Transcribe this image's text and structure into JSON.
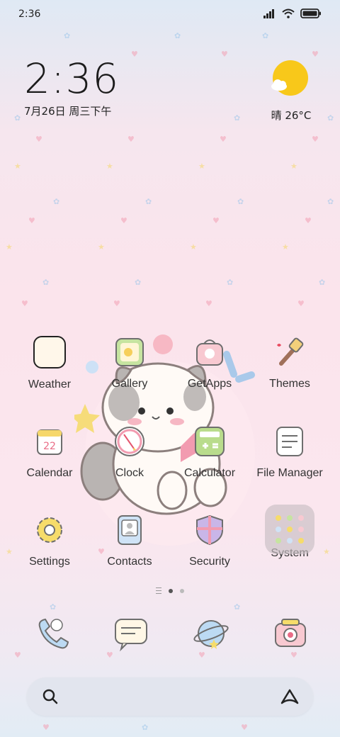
{
  "status_bar": {
    "time": "2:36"
  },
  "clock_widget": {
    "time": "2:36",
    "date": "7月26日 周三下午"
  },
  "weather_widget": {
    "condition_temp": "晴 26°C",
    "sun_color": "#f8c81a"
  },
  "apps": [
    {
      "label": "Weather",
      "icon": "weather-icon"
    },
    {
      "label": "Gallery",
      "icon": "gallery-icon"
    },
    {
      "label": "GetApps",
      "icon": "getapps-icon"
    },
    {
      "label": "Themes",
      "icon": "themes-icon"
    },
    {
      "label": "Calendar",
      "icon": "calendar-icon",
      "day": "22"
    },
    {
      "label": "Clock",
      "icon": "clock-icon"
    },
    {
      "label": "Calculator",
      "icon": "calculator-icon"
    },
    {
      "label": "File Manager",
      "icon": "file-manager-icon"
    },
    {
      "label": "Settings",
      "icon": "settings-icon"
    },
    {
      "label": "Contacts",
      "icon": "contacts-icon"
    },
    {
      "label": "Security",
      "icon": "security-icon"
    },
    {
      "label": "System",
      "icon": "system-folder-icon"
    }
  ],
  "page_indicator": {
    "pages": 2,
    "active": 1
  },
  "dock": [
    {
      "icon": "phone-icon"
    },
    {
      "icon": "messages-icon"
    },
    {
      "icon": "browser-icon"
    },
    {
      "icon": "camera-icon"
    }
  ],
  "search": {
    "icon": "search-icon",
    "assistant_icon": "assistant-icon"
  },
  "colors": {
    "accent_pink": "#f4a6b6",
    "accent_green": "#b9dc8c",
    "accent_yellow": "#f6dc6a"
  }
}
